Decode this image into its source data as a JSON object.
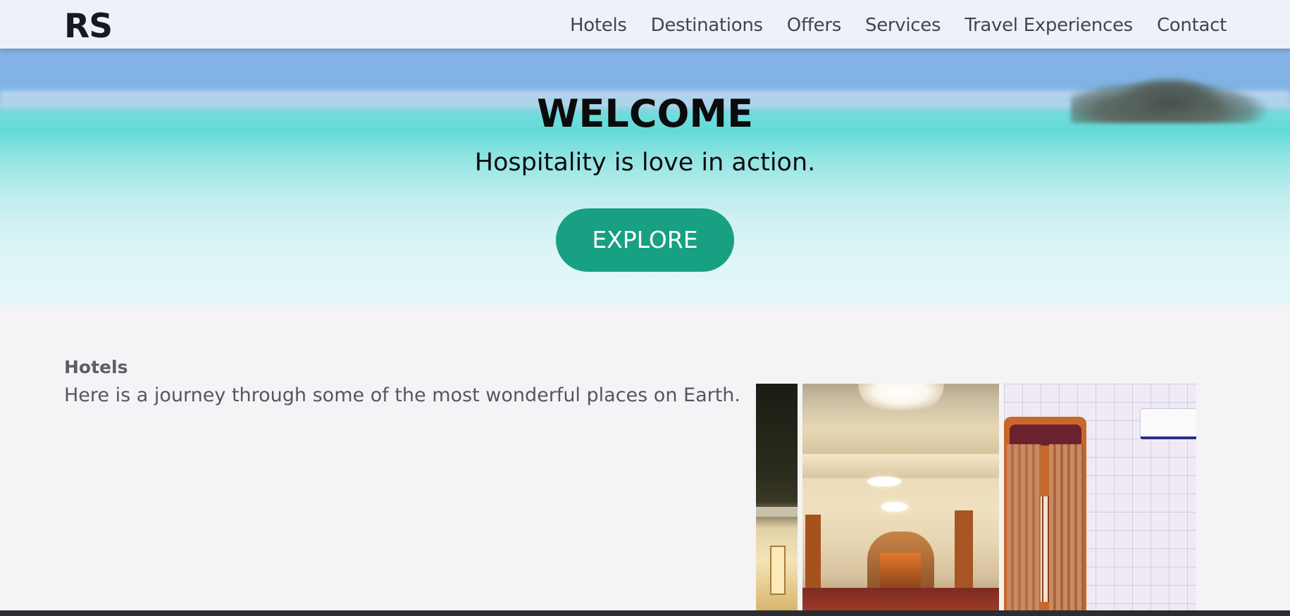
{
  "navbar": {
    "logo": "RS",
    "links": [
      "Hotels",
      "Destinations",
      "Offers",
      "Services",
      "Travel Experiences",
      "Contact"
    ]
  },
  "hero": {
    "heading": "WELCOME",
    "tagline": "Hospitality is love in action.",
    "button_label": "EXPLORE"
  },
  "hotels_section": {
    "title": "Hotels",
    "description": "Here is a journey through some of the most wonderful places on Earth."
  },
  "colors": {
    "accent": "#17a081",
    "nav_bg": "#eef2f8",
    "page_bg": "#f4f4f6"
  }
}
